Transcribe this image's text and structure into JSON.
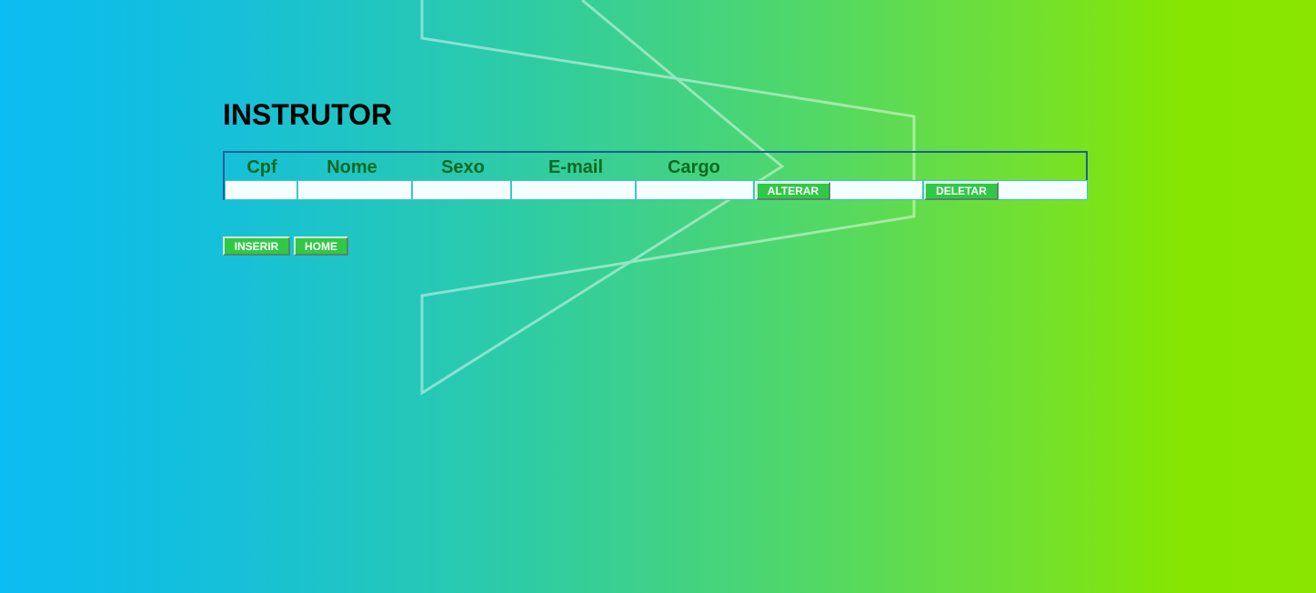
{
  "page": {
    "title": "INSTRUTOR"
  },
  "table": {
    "headers": [
      "Cpf",
      "Nome",
      "Sexo",
      "E-mail",
      "Cargo"
    ],
    "row": {
      "alter_label": "ALTERAR",
      "delete_label": "DELETAR"
    }
  },
  "actions": {
    "insert_label": "INSERIR",
    "home_label": "HOME"
  },
  "colors": {
    "background_start": "#0bbcf0",
    "background_end": "#8ae600",
    "header_text": "#0b6a20",
    "button": "#31c846",
    "table_border": "#1c5f96"
  }
}
